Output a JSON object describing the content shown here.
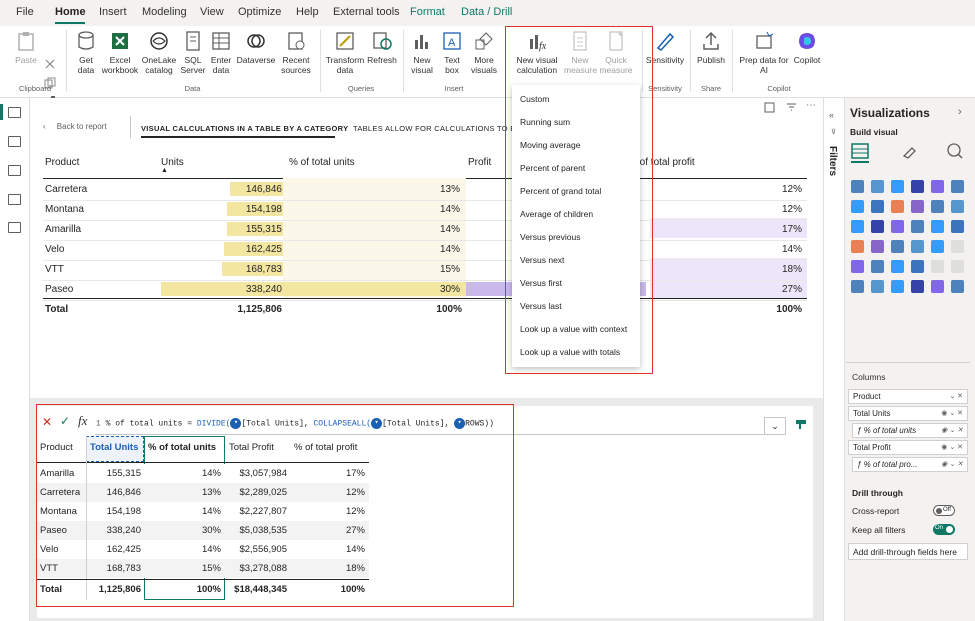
{
  "menu": {
    "file": "File",
    "home": "Home",
    "insert": "Insert",
    "modeling": "Modeling",
    "view": "View",
    "optimize": "Optimize",
    "help": "Help",
    "external": "External tools",
    "format": "Format",
    "data_drill": "Data / Drill"
  },
  "ribbon": {
    "paste": "Paste",
    "get_data": "Get data",
    "excel": "Excel workbook",
    "onelake": "OneLake catalog",
    "sql": "SQL Server",
    "enter": "Enter data",
    "dataverse": "Dataverse",
    "recent": "Recent sources",
    "transform": "Transform data",
    "refresh": "Refresh",
    "new_visual": "New visual",
    "text_box": "Text box",
    "more_visuals": "More visuals",
    "new_visual_calc": "New visual calculation",
    "new_measure": "New measure",
    "quick_measure": "Quick measure",
    "sensitivity": "Sensitivity",
    "publish": "Publish",
    "prep_data": "Prep data for AI",
    "copilot": "Copilot",
    "groups": {
      "clipboard": "Clipboard",
      "data": "Data",
      "queries": "Queries",
      "insert": "Insert",
      "sensitivity": "Sensitivity",
      "share": "Share",
      "copilot": "Copilot"
    }
  },
  "report": {
    "back": "Back to report",
    "tab1": "VISUAL CALCULATIONS IN A TABLE BY A CATEGORY",
    "tab2": "TABLES ALLOW FOR CALCULATIONS TO BE",
    "headers": {
      "product": "Product",
      "units": "Units",
      "pct_units": "% of total units",
      "profit": "Profit",
      "pct_profit": "% of total profit"
    },
    "rows": [
      {
        "product": "Carretera",
        "units": "146,846",
        "pct_units": "13%",
        "pct_profit": "12%",
        "units_frac": 0.434,
        "profit_frac": 0
      },
      {
        "product": "Montana",
        "units": "154,198",
        "pct_units": "14%",
        "pct_profit": "12%",
        "units_frac": 0.456,
        "profit_frac": 0
      },
      {
        "product": "Amarilla",
        "units": "155,315",
        "pct_units": "14%",
        "pct_profit": "17%",
        "units_frac": 0.459,
        "profit_frac": 0
      },
      {
        "product": "Velo",
        "units": "162,425",
        "pct_units": "14%",
        "pct_profit": "14%",
        "units_frac": 0.48,
        "profit_frac": 0
      },
      {
        "product": "VTT",
        "units": "168,783",
        "pct_units": "15%",
        "pct_profit": "18%",
        "units_frac": 0.499,
        "profit_frac": 0
      },
      {
        "product": "Paseo",
        "units": "338,240",
        "pct_units": "30%",
        "pct_profit": "27%",
        "units_frac": 1.0,
        "profit_frac": 1.0
      }
    ],
    "total": {
      "label": "Total",
      "units": "1,125,806",
      "pct_units": "100%",
      "pct_profit": "100%"
    }
  },
  "dropdown": [
    "Custom",
    "Running sum",
    "Moving average",
    "Percent of parent",
    "Percent of grand total",
    "Average of children",
    "Versus previous",
    "Versus next",
    "Versus first",
    "Versus last",
    "Look up a value with context",
    "Look up a value with totals"
  ],
  "vc": {
    "formula_line": "1",
    "formula_a": "% of total units = ",
    "formula_fn": "DIVIDE(",
    "formula_b": "[Total Units], ",
    "formula_fn2": "COLLAPSEALL(",
    "formula_c": "[Total Units], ",
    "formula_d": "ROWS))",
    "headers": {
      "product": "Product",
      "total_units": "Total Units",
      "pct_units": "% of total units",
      "total_profit": "Total Profit",
      "pct_profit": "% of total profit"
    },
    "rows": [
      {
        "product": "Amarilla",
        "units": "155,315",
        "pct_units": "14%",
        "profit": "$3,057,984",
        "pct_profit": "17%"
      },
      {
        "product": "Carretera",
        "units": "146,846",
        "pct_units": "13%",
        "profit": "$2,289,025",
        "pct_profit": "12%"
      },
      {
        "product": "Montana",
        "units": "154,198",
        "pct_units": "14%",
        "profit": "$2,227,807",
        "pct_profit": "12%"
      },
      {
        "product": "Paseo",
        "units": "338,240",
        "pct_units": "30%",
        "profit": "$5,038,535",
        "pct_profit": "27%"
      },
      {
        "product": "Velo",
        "units": "162,425",
        "pct_units": "14%",
        "profit": "$2,556,905",
        "pct_profit": "14%"
      },
      {
        "product": "VTT",
        "units": "168,783",
        "pct_units": "15%",
        "profit": "$3,278,088",
        "pct_profit": "18%"
      }
    ],
    "total": {
      "label": "Total",
      "units": "1,125,806",
      "pct_units": "100%",
      "profit": "$18,448,345",
      "pct_profit": "100%"
    }
  },
  "viz": {
    "title": "Visualizations",
    "build": "Build visual",
    "filters": "Filters",
    "columns": "Columns",
    "fields": [
      "Product",
      "Total Units",
      "% of total units",
      "Total Profit",
      "% of total pro..."
    ],
    "drill": "Drill through",
    "cross": "Cross-report",
    "cross_state": "Off",
    "keep": "Keep all filters",
    "keep_state": "On",
    "add_drill": "Add drill-through fields here"
  },
  "colors": {
    "accent": "#117865",
    "units_bar": "#f2e6a0",
    "profit_bar": "#c9b8ea",
    "red": "#e03030"
  }
}
